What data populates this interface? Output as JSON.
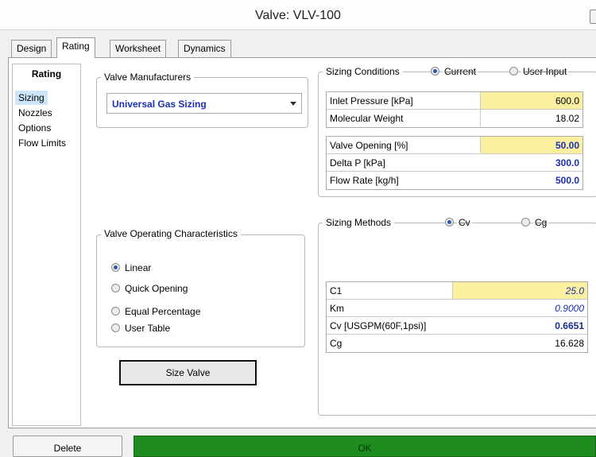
{
  "window": {
    "title": "Valve: VLV-100"
  },
  "tabs": [
    {
      "label": "Design"
    },
    {
      "label": "Rating"
    },
    {
      "label": "Worksheet"
    },
    {
      "label": "Dynamics"
    }
  ],
  "nav": {
    "header": "Rating",
    "items": [
      {
        "label": "Sizing",
        "selected": true
      },
      {
        "label": "Nozzles"
      },
      {
        "label": "Options"
      },
      {
        "label": "Flow Limits"
      }
    ]
  },
  "valve_manufacturers": {
    "legend": "Valve Manufacturers",
    "selected": "Universal Gas Sizing"
  },
  "operating_characteristics": {
    "legend": "Valve Operating Characteristics",
    "options": [
      {
        "label": "Linear",
        "checked": true
      },
      {
        "label": "Quick Opening",
        "checked": false
      },
      {
        "label": "Equal Percentage",
        "checked": false
      },
      {
        "label": "User Table",
        "checked": false
      }
    ]
  },
  "sizing_conditions": {
    "legend": "Sizing Conditions",
    "radio_current": "Current",
    "radio_user_input": "User Input",
    "table1": [
      {
        "label": "Inlet Pressure [kPa]",
        "value": "600.0"
      },
      {
        "label": "Molecular Weight",
        "value": "18.02"
      }
    ],
    "table2": [
      {
        "label": "Valve Opening [%]",
        "value": "50.00"
      },
      {
        "label": "Delta P [kPa]",
        "value": "300.0"
      },
      {
        "label": "Flow Rate [kg/h]",
        "value": "500.0"
      }
    ]
  },
  "sizing_methods": {
    "legend": "Sizing Methods",
    "radio_cv": "Cv",
    "radio_cg": "Cg",
    "table": [
      {
        "label": "C1",
        "value": "25.0"
      },
      {
        "label": "Km",
        "value": "0.9000"
      },
      {
        "label": "Cv [USGPM(60F,1psi)]",
        "value": "0.6651"
      },
      {
        "label": "Cg",
        "value": "16.628"
      }
    ]
  },
  "buttons": {
    "size_valve": "Size Valve",
    "delete": "Delete"
  },
  "status": {
    "text": "OK",
    "color": "#1e8c1e"
  },
  "colors": {
    "highlight": "#faf0a0",
    "value_blue": "#1a2fb3",
    "selection": "#cce5f8"
  }
}
